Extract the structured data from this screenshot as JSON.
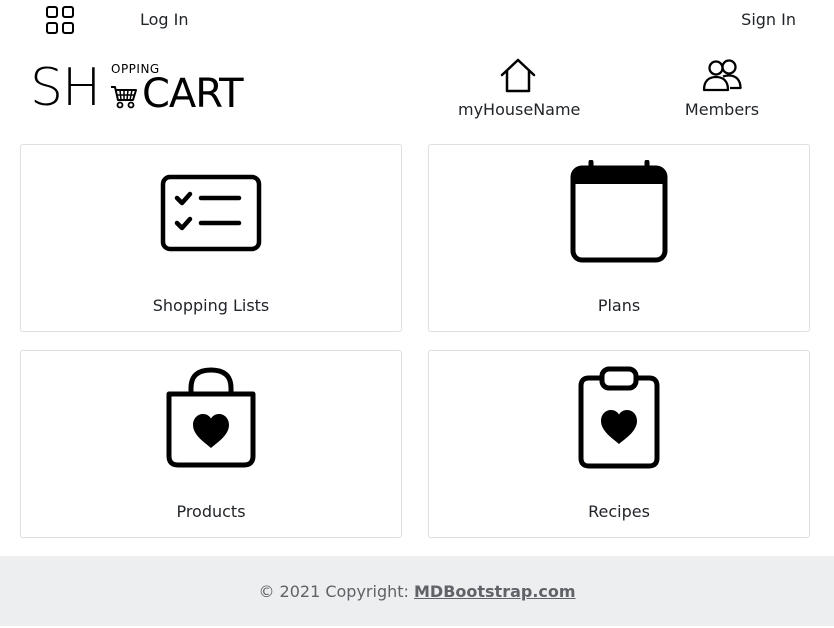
{
  "topbar": {
    "menu_icon": "grid-icon",
    "login_label": "Log In",
    "signin_label": "Sign In"
  },
  "logo": {
    "sh": "SH",
    "opping": "OPPING",
    "cart": "CART",
    "cart_icon": "shopping-cart-icon"
  },
  "nav": {
    "house": {
      "label": "myHouseName",
      "icon": "house-icon"
    },
    "members": {
      "label": "Members",
      "icon": "members-icon"
    }
  },
  "cards": [
    {
      "label": "Shopping Lists",
      "icon": "checklist-icon"
    },
    {
      "label": "Plans",
      "icon": "calendar-icon"
    },
    {
      "label": "Products",
      "icon": "shopping-bag-heart-icon"
    },
    {
      "label": "Recipes",
      "icon": "clipboard-heart-icon"
    }
  ],
  "footer": {
    "text": "© 2021 Copyright: ",
    "link": "MDBootstrap.com"
  },
  "colors": {
    "footer_bg": "#eceeef",
    "card_border": "#dfdfdf",
    "text": "#212529"
  }
}
